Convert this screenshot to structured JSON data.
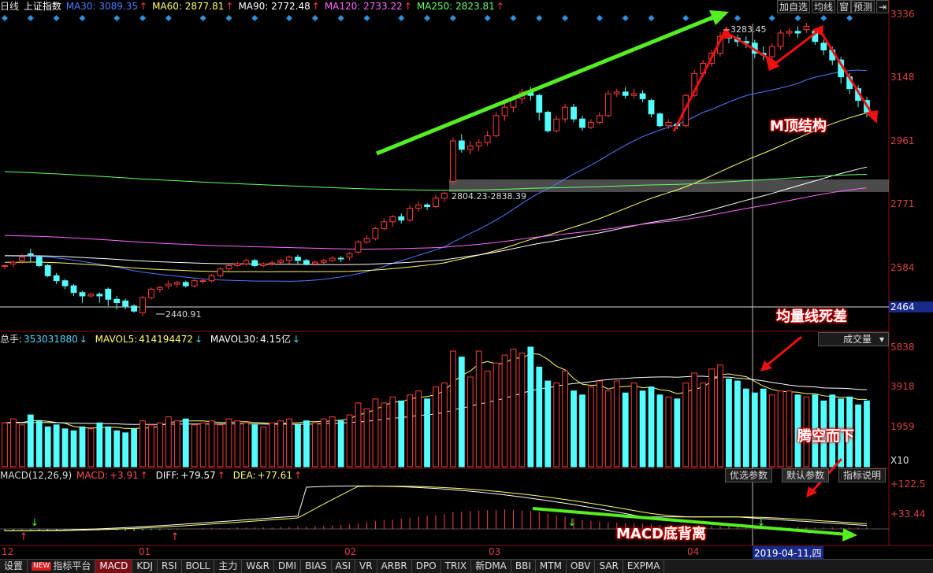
{
  "top_legend": {
    "period": "日线",
    "name": "上证指数",
    "ma": [
      {
        "label": "MA30: 3089.35",
        "color": "#4f7cff"
      },
      {
        "label": "MA60: 2877.81",
        "color": "#ffff66"
      },
      {
        "label": "MA90: 2772.48",
        "color": "#ffffff"
      },
      {
        "label": "MA120: 2733.22",
        "color": "#ff66ff"
      },
      {
        "label": "MA250: 2823.81",
        "color": "#66ff66"
      }
    ]
  },
  "top_buttons": [
    "加自选",
    "均线",
    "窗",
    "预测"
  ],
  "price_axis": {
    "ticks": [
      "3336",
      "3148",
      "2961",
      "2771",
      "2584"
    ],
    "current": "2464"
  },
  "annotations": {
    "high_label": "3283.45",
    "low_label": "2440.91",
    "gap_label": "2804.23-2838.39",
    "m_top": "M顶结构",
    "vol_dead_cross": "均量线死差",
    "gap_down": "腾空而下",
    "macd_divergence": "MACD底背离"
  },
  "volume_legend": {
    "total_label": "总手:",
    "total": "353031880",
    "mavol5_label": "MAVOL5:",
    "mavol5": "414194472",
    "mavol30_label": "MAVOL30:",
    "mavol30": "4.15亿"
  },
  "volume_axis": {
    "ticks": [
      "5838",
      "3918",
      "1959"
    ],
    "unit": "X10"
  },
  "volume_dropdown": "成交量",
  "macd_legend": {
    "params": "MACD(12,26,9)",
    "macd_label": "MACD:",
    "macd": "+3.91",
    "diff_label": "DIFF:",
    "diff": "+79.57",
    "dea_label": "DEA:",
    "dea": "+77.61"
  },
  "macd_axis": {
    "ticks": [
      "+122.5",
      "+33.44"
    ]
  },
  "macd_buttons": [
    "优选参数",
    "默认参数",
    "指标说明"
  ],
  "date_axis": {
    "labels": [
      "12",
      "01",
      "02",
      "03",
      "04"
    ],
    "cursor_date": "2019-04-11,四"
  },
  "bottom_tabs": [
    "设置",
    "指标平台",
    "MACD",
    "KDJ",
    "RSI",
    "BOLL",
    "主力",
    "W&R",
    "DMI",
    "BIAS",
    "ASI",
    "VR",
    "ARBR",
    "DPO",
    "TRIX",
    "新DMA",
    "BBI",
    "MTM",
    "OBV",
    "SAR",
    "EXPMA"
  ],
  "new_badge": "NEW",
  "chart_data": {
    "type": "candlestick",
    "ylim": [
      2440,
      3340
    ],
    "candles": [
      [
        2588,
        2590,
        2580,
        2592
      ],
      [
        2595,
        2600,
        2585,
        2605
      ],
      [
        2605,
        2615,
        2595,
        2625
      ],
      [
        2625,
        2622,
        2600,
        2640
      ],
      [
        2615,
        2590,
        2585,
        2618
      ],
      [
        2590,
        2560,
        2555,
        2595
      ],
      [
        2560,
        2545,
        2535,
        2568
      ],
      [
        2545,
        2530,
        2520,
        2550
      ],
      [
        2530,
        2510,
        2500,
        2535
      ],
      [
        2510,
        2500,
        2480,
        2515
      ],
      [
        2500,
        2505,
        2495,
        2510
      ],
      [
        2505,
        2500,
        2480,
        2510
      ],
      [
        2520,
        2490,
        2470,
        2525
      ],
      [
        2490,
        2480,
        2460,
        2500
      ],
      [
        2485,
        2470,
        2460,
        2492
      ],
      [
        2470,
        2455,
        2450,
        2475
      ],
      [
        2450,
        2495,
        2440,
        2500
      ],
      [
        2495,
        2520,
        2490,
        2525
      ],
      [
        2520,
        2525,
        2510,
        2530
      ],
      [
        2530,
        2535,
        2520,
        2545
      ],
      [
        2535,
        2540,
        2525,
        2545
      ],
      [
        2540,
        2530,
        2525,
        2545
      ],
      [
        2530,
        2545,
        2525,
        2550
      ],
      [
        2545,
        2545,
        2535,
        2550
      ],
      [
        2545,
        2560,
        2540,
        2565
      ],
      [
        2560,
        2580,
        2555,
        2585
      ],
      [
        2580,
        2590,
        2575,
        2595
      ],
      [
        2590,
        2595,
        2585,
        2600
      ],
      [
        2595,
        2605,
        2590,
        2610
      ],
      [
        2605,
        2590,
        2585,
        2610
      ],
      [
        2590,
        2595,
        2585,
        2600
      ],
      [
        2595,
        2598,
        2590,
        2605
      ],
      [
        2600,
        2605,
        2595,
        2610
      ],
      [
        2605,
        2615,
        2595,
        2620
      ],
      [
        2615,
        2605,
        2595,
        2622
      ],
      [
        2605,
        2595,
        2590,
        2610
      ],
      [
        2595,
        2600,
        2590,
        2605
      ],
      [
        2600,
        2605,
        2595,
        2610
      ],
      [
        2605,
        2612,
        2600,
        2618
      ],
      [
        2612,
        2610,
        2600,
        2618
      ],
      [
        2615,
        2625,
        2605,
        2630
      ],
      [
        2630,
        2660,
        2625,
        2665
      ],
      [
        2660,
        2670,
        2655,
        2680
      ],
      [
        2670,
        2700,
        2665,
        2705
      ],
      [
        2700,
        2720,
        2695,
        2730
      ],
      [
        2720,
        2735,
        2705,
        2740
      ],
      [
        2735,
        2725,
        2715,
        2745
      ],
      [
        2725,
        2760,
        2720,
        2770
      ],
      [
        2760,
        2770,
        2750,
        2780
      ],
      [
        2770,
        2765,
        2755,
        2775
      ],
      [
        2765,
        2790,
        2760,
        2800
      ],
      [
        2790,
        2805,
        2780,
        2810
      ],
      [
        2840,
        2960,
        2830,
        2970
      ],
      [
        2960,
        2935,
        2925,
        2980
      ],
      [
        2935,
        2945,
        2920,
        2960
      ],
      [
        2945,
        2955,
        2930,
        2965
      ],
      [
        2955,
        2975,
        2945,
        2990
      ],
      [
        2975,
        3035,
        2970,
        3045
      ],
      [
        3035,
        3060,
        3020,
        3070
      ],
      [
        3060,
        3085,
        3045,
        3095
      ],
      [
        3085,
        3105,
        3070,
        3115
      ],
      [
        3105,
        3095,
        3080,
        3120
      ],
      [
        3095,
        3045,
        3020,
        3100
      ],
      [
        3045,
        2990,
        2985,
        3050
      ],
      [
        2990,
        3025,
        2985,
        3035
      ],
      [
        3025,
        3060,
        3015,
        3070
      ],
      [
        3060,
        3025,
        3015,
        3070
      ],
      [
        3025,
        3000,
        2990,
        3035
      ],
      [
        3000,
        3015,
        2995,
        3025
      ],
      [
        3015,
        3035,
        3010,
        3045
      ],
      [
        3035,
        3100,
        3030,
        3110
      ],
      [
        3100,
        3105,
        3090,
        3115
      ],
      [
        3105,
        3095,
        3085,
        3120
      ],
      [
        3095,
        3100,
        3085,
        3115
      ],
      [
        3100,
        3085,
        3075,
        3110
      ],
      [
        3080,
        3040,
        3030,
        3085
      ],
      [
        3040,
        3005,
        3000,
        3045
      ],
      [
        3005,
        3015,
        2995,
        3025
      ],
      [
        3010,
        3005,
        2995,
        3015
      ],
      [
        3005,
        3095,
        3000,
        3100
      ],
      [
        3095,
        3160,
        3090,
        3170
      ],
      [
        3160,
        3190,
        3150,
        3200
      ],
      [
        3190,
        3220,
        3180,
        3230
      ],
      [
        3220,
        3270,
        3210,
        3283
      ],
      [
        3270,
        3265,
        3250,
        3280
      ],
      [
        3265,
        3255,
        3240,
        3275
      ],
      [
        3255,
        3250,
        3235,
        3270
      ],
      [
        3250,
        3220,
        3205,
        3260
      ],
      [
        3220,
        3215,
        3200,
        3240
      ],
      [
        3210,
        3240,
        3200,
        3250
      ],
      [
        3240,
        3280,
        3230,
        3290
      ],
      [
        3280,
        3285,
        3270,
        3295
      ],
      [
        3285,
        3280,
        3265,
        3300
      ],
      [
        3290,
        3300,
        3280,
        3310
      ],
      [
        3285,
        3255,
        3245,
        3290
      ],
      [
        3250,
        3230,
        3215,
        3260
      ],
      [
        3230,
        3200,
        3185,
        3240
      ],
      [
        3200,
        3150,
        3130,
        3210
      ],
      [
        3150,
        3115,
        3100,
        3160
      ],
      [
        3115,
        3080,
        3060,
        3125
      ],
      [
        3080,
        3045,
        3030,
        3090
      ]
    ],
    "volume": [
      2200,
      2400,
      2100,
      2600,
      2300,
      2000,
      2100,
      1900,
      1800,
      2000,
      1900,
      2200,
      2000,
      1800,
      1700,
      1900,
      2300,
      2100,
      2200,
      2500,
      2300,
      2400,
      2100,
      2200,
      2300,
      2100,
      2400,
      2300,
      2200,
      2100,
      2000,
      2200,
      2300,
      2400,
      2100,
      2300,
      2200,
      2400,
      2500,
      2300,
      2600,
      3200,
      2900,
      3400,
      3200,
      3500,
      3300,
      3600,
      3800,
      3400,
      4000,
      4200,
      5800,
      5500,
      4500,
      5800,
      4800,
      5200,
      5600,
      5900,
      5700,
      6000,
      5000,
      4300,
      4200,
      4800,
      3800,
      3600,
      4000,
      4300,
      3800,
      4300,
      3700,
      4200,
      3800,
      4000,
      3600,
      3500,
      3400,
      4200,
      4700,
      4200,
      4900,
      5100,
      4400,
      4300,
      3900,
      3700,
      3900,
      3600,
      3800,
      3800,
      3600,
      3500,
      3600,
      3300,
      3600,
      3400,
      3500,
      3100,
      3300
    ],
    "macd_hist": [
      -5,
      -3,
      -2,
      -2,
      -3,
      -4,
      -4,
      -3,
      -3,
      -2,
      -2,
      -1,
      -2,
      -3,
      -4,
      -4,
      -3,
      -2,
      -2,
      -1,
      -1,
      0,
      1,
      2,
      2,
      2,
      2,
      3,
      3,
      3,
      3,
      3,
      4,
      4,
      5,
      5,
      6,
      6,
      7,
      8,
      9,
      11,
      13,
      15,
      17,
      18,
      20,
      22,
      24,
      26,
      27,
      29,
      33,
      34,
      35,
      36,
      37,
      37,
      38,
      37,
      36,
      35,
      33,
      30,
      27,
      24,
      21,
      18,
      16,
      14,
      13,
      12,
      12,
      11,
      10,
      9,
      8,
      7,
      6,
      6,
      6,
      6,
      6,
      6,
      5,
      5,
      5,
      5,
      4,
      4,
      4,
      4,
      4,
      3,
      3,
      3,
      3,
      3,
      3,
      3,
      3.91
    ]
  }
}
